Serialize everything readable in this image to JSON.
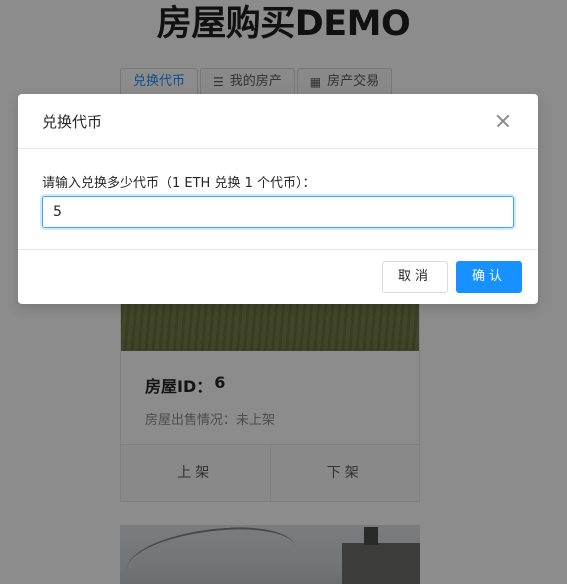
{
  "page": {
    "title": "房屋购买DEMO",
    "tabs": [
      {
        "label": "兑换代币",
        "icon": ""
      },
      {
        "label": "我的房产",
        "icon": "list-icon"
      },
      {
        "label": "房产交易",
        "icon": "grid-icon"
      }
    ],
    "card": {
      "house_id_label": "房屋ID：",
      "house_id_value": "6",
      "sale_label": "房屋出售情况：",
      "sale_value": "未上架",
      "list_action": "上架",
      "delist_action": "下架"
    }
  },
  "modal": {
    "title": "兑换代币",
    "prompt": "请输入兑换多少代币（1 ETH 兑换 1 个代币）：",
    "input_value": "5",
    "cancel_label": "取消",
    "ok_label": "确认"
  },
  "colors": {
    "primary": "#1890ff",
    "mask": "rgba(0,0,0,0.45)"
  }
}
